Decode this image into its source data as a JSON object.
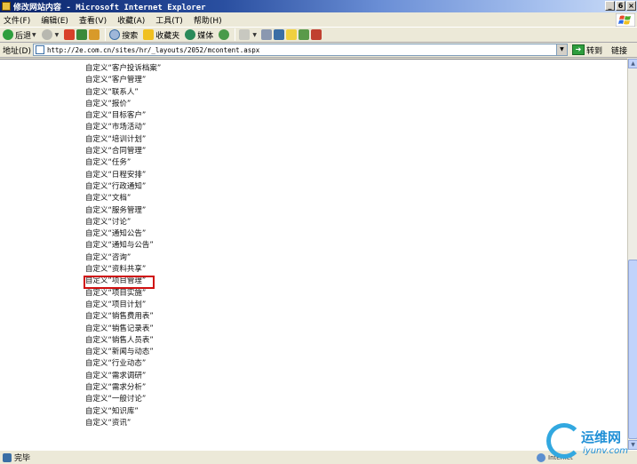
{
  "window": {
    "title": "修改网站内容 - Microsoft Internet Explorer",
    "minimize": "_",
    "restore": "6",
    "close": "×"
  },
  "menu": [
    "文件(F)",
    "编辑(E)",
    "查看(V)",
    "收藏(A)",
    "工具(T)",
    "帮助(H)"
  ],
  "toolbar": {
    "back": "后退",
    "search": "搜索",
    "favorites": "收藏夹",
    "media": "媒体"
  },
  "address": {
    "label": "地址(D)",
    "url": "http://2e.com.cn/sites/hr/_layouts/2052/mcontent.aspx",
    "go": "转到",
    "links": "链接"
  },
  "list": [
    "自定义“客户投诉档案”",
    "自定义“客户管理”",
    "自定义“联系人”",
    "自定义“报价”",
    "自定义“目标客户”",
    "自定义“市场活动”",
    "自定义“培训计划”",
    "自定义“合同管理”",
    "自定义“任务”",
    "自定义“日程安排”",
    "自定义“行政通知”",
    "自定义“文档”",
    "自定义“服务管理”",
    "自定义“讨论”",
    "自定义“通知公告”",
    "自定义“通知与公告”",
    "自定义“咨询”",
    "自定义“资料共享”",
    "自定义“项目管理”",
    "自定义“项目实施”",
    "自定义“项目计划”",
    "自定义“销售费用表”",
    "自定义“销售记录表”",
    "自定义“销售人员表”",
    "自定义“新闻与动态”",
    "自定义“行业动态”",
    "自定义“需求调研”",
    "自定义“需求分析”",
    "自定义“一般讨论”",
    "自定义“知识库”",
    "自定义“资讯”"
  ],
  "status": {
    "text": "完毕",
    "zone": "Internet"
  },
  "watermark": {
    "line1": "运维网",
    "line2": "iyunv.com"
  }
}
